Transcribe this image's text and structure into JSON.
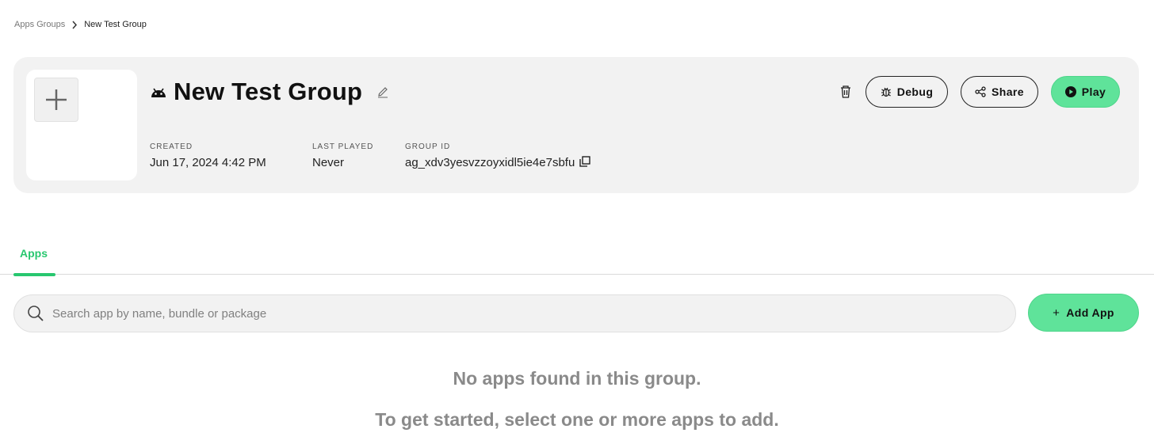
{
  "breadcrumb": {
    "parent": "Apps Groups",
    "current": "New Test Group"
  },
  "group": {
    "name": "New Test Group",
    "platform_icon": "android-icon",
    "created_label": "CREATED",
    "created_value": "Jun 17, 2024 4:42 PM",
    "last_played_label": "LAST PLAYED",
    "last_played_value": "Never",
    "group_id_label": "GROUP ID",
    "group_id_value": "ag_xdv3yesvzzoyxidl5ie4e7sbfu"
  },
  "actions": {
    "debug_label": "Debug",
    "share_label": "Share",
    "play_label": "Play"
  },
  "tabs": [
    {
      "label": "Apps",
      "active": true
    }
  ],
  "search": {
    "placeholder": "Search app by name, bundle or package",
    "value": ""
  },
  "add_app": {
    "icon": "+",
    "label": "Add App"
  },
  "empty_state": {
    "line1": "No apps found in this group.",
    "line2": "To get started, select one or more apps to add."
  },
  "colors": {
    "accent": "#28c76f",
    "button_green": "#5fe39a",
    "card_bg": "#f2f2f2"
  }
}
